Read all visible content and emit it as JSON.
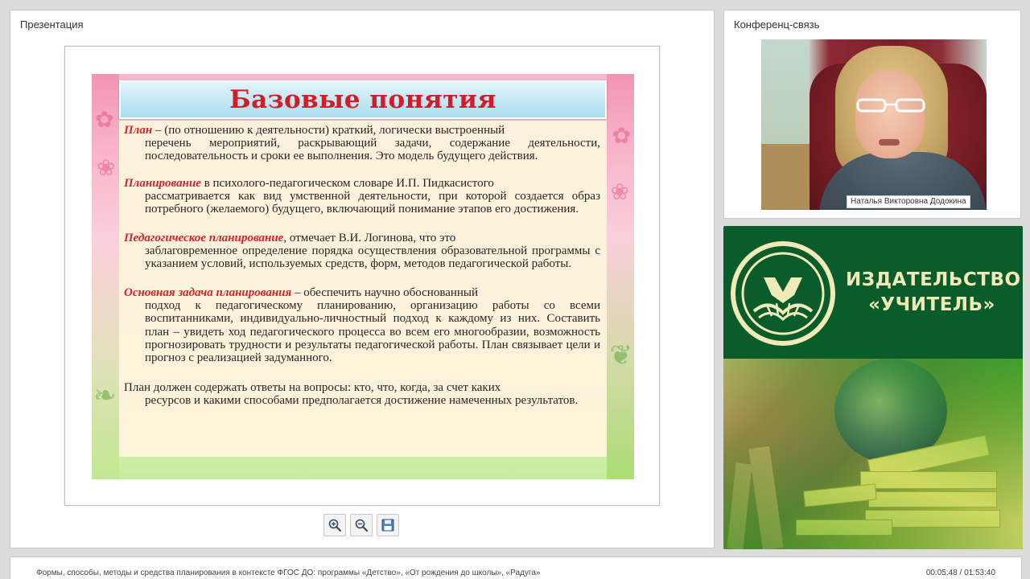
{
  "presentation": {
    "title": "Презентация",
    "slide": {
      "heading": "Базовые понятия",
      "paragraphs": [
        {
          "term": "План",
          "first": " – (по отношению к деятельности) краткий, логически выстроенный",
          "rest": "перечень мероприятий, раскрывающий задачи, содержание деятельности, последовательность и сроки ее выполнения. Это модель будущего действия."
        },
        {
          "term": "Планирование",
          "first": " в психолого-педагогическом словаре И.П. Пидкасистого",
          "rest": "рассматривается как вид умственной деятельности, при которой создается образ потребного (желаемого) будущего, включающий понимание этапов его достижения."
        },
        {
          "term": "Педагогическое планирование",
          "first": ", отмечает В.И. Логинова, что это",
          "rest": "заблаговременное определение порядка осуществления образовательной программы с указанием условий, используемых средств, форм, методов педагогической работы."
        },
        {
          "term": "Основная задача планирования",
          "first": " – обеспечить научно обоснованный",
          "rest": "подход к педагогическому планированию, организацию работы со всеми воспитанниками, индивидуально-личностный подход к каждому из них. Составить план – увидеть ход педагогического процесса во всем его многообразии, возможность прогнозировать трудности и результаты педагогической работы. План связывает цели и прогноз с реализацией задуманного."
        },
        {
          "term": "",
          "first": "План должен содержать ответы на вопросы: кто, что, когда, за счет каких",
          "rest": "ресурсов и какими способами предполагается достижение намеченных результатов."
        }
      ]
    },
    "toolbar": {
      "zoom_in_icon": "zoom-in-icon",
      "zoom_out_icon": "zoom-out-icon",
      "save_icon": "floppy-disk-icon"
    }
  },
  "conference": {
    "title": "Конференц-связь",
    "participant_name": "Наталья Викторовна Додокина"
  },
  "publisher": {
    "name_line1": "ИЗДАТЕЛЬСТВО",
    "name_line2": "«УЧИТЕЛЬ»"
  },
  "footer": {
    "course_title": "Формы, способы, методы и средства планирования в контексте ФГОС ДО: программы «Детство», «От рождения до школы», «Радуга»",
    "time": "00:05:48 / 01:53:40"
  },
  "colors": {
    "term_red": "#d51b25",
    "publisher_green": "#0a5c2a",
    "publisher_gold": "#f0e9b8"
  }
}
